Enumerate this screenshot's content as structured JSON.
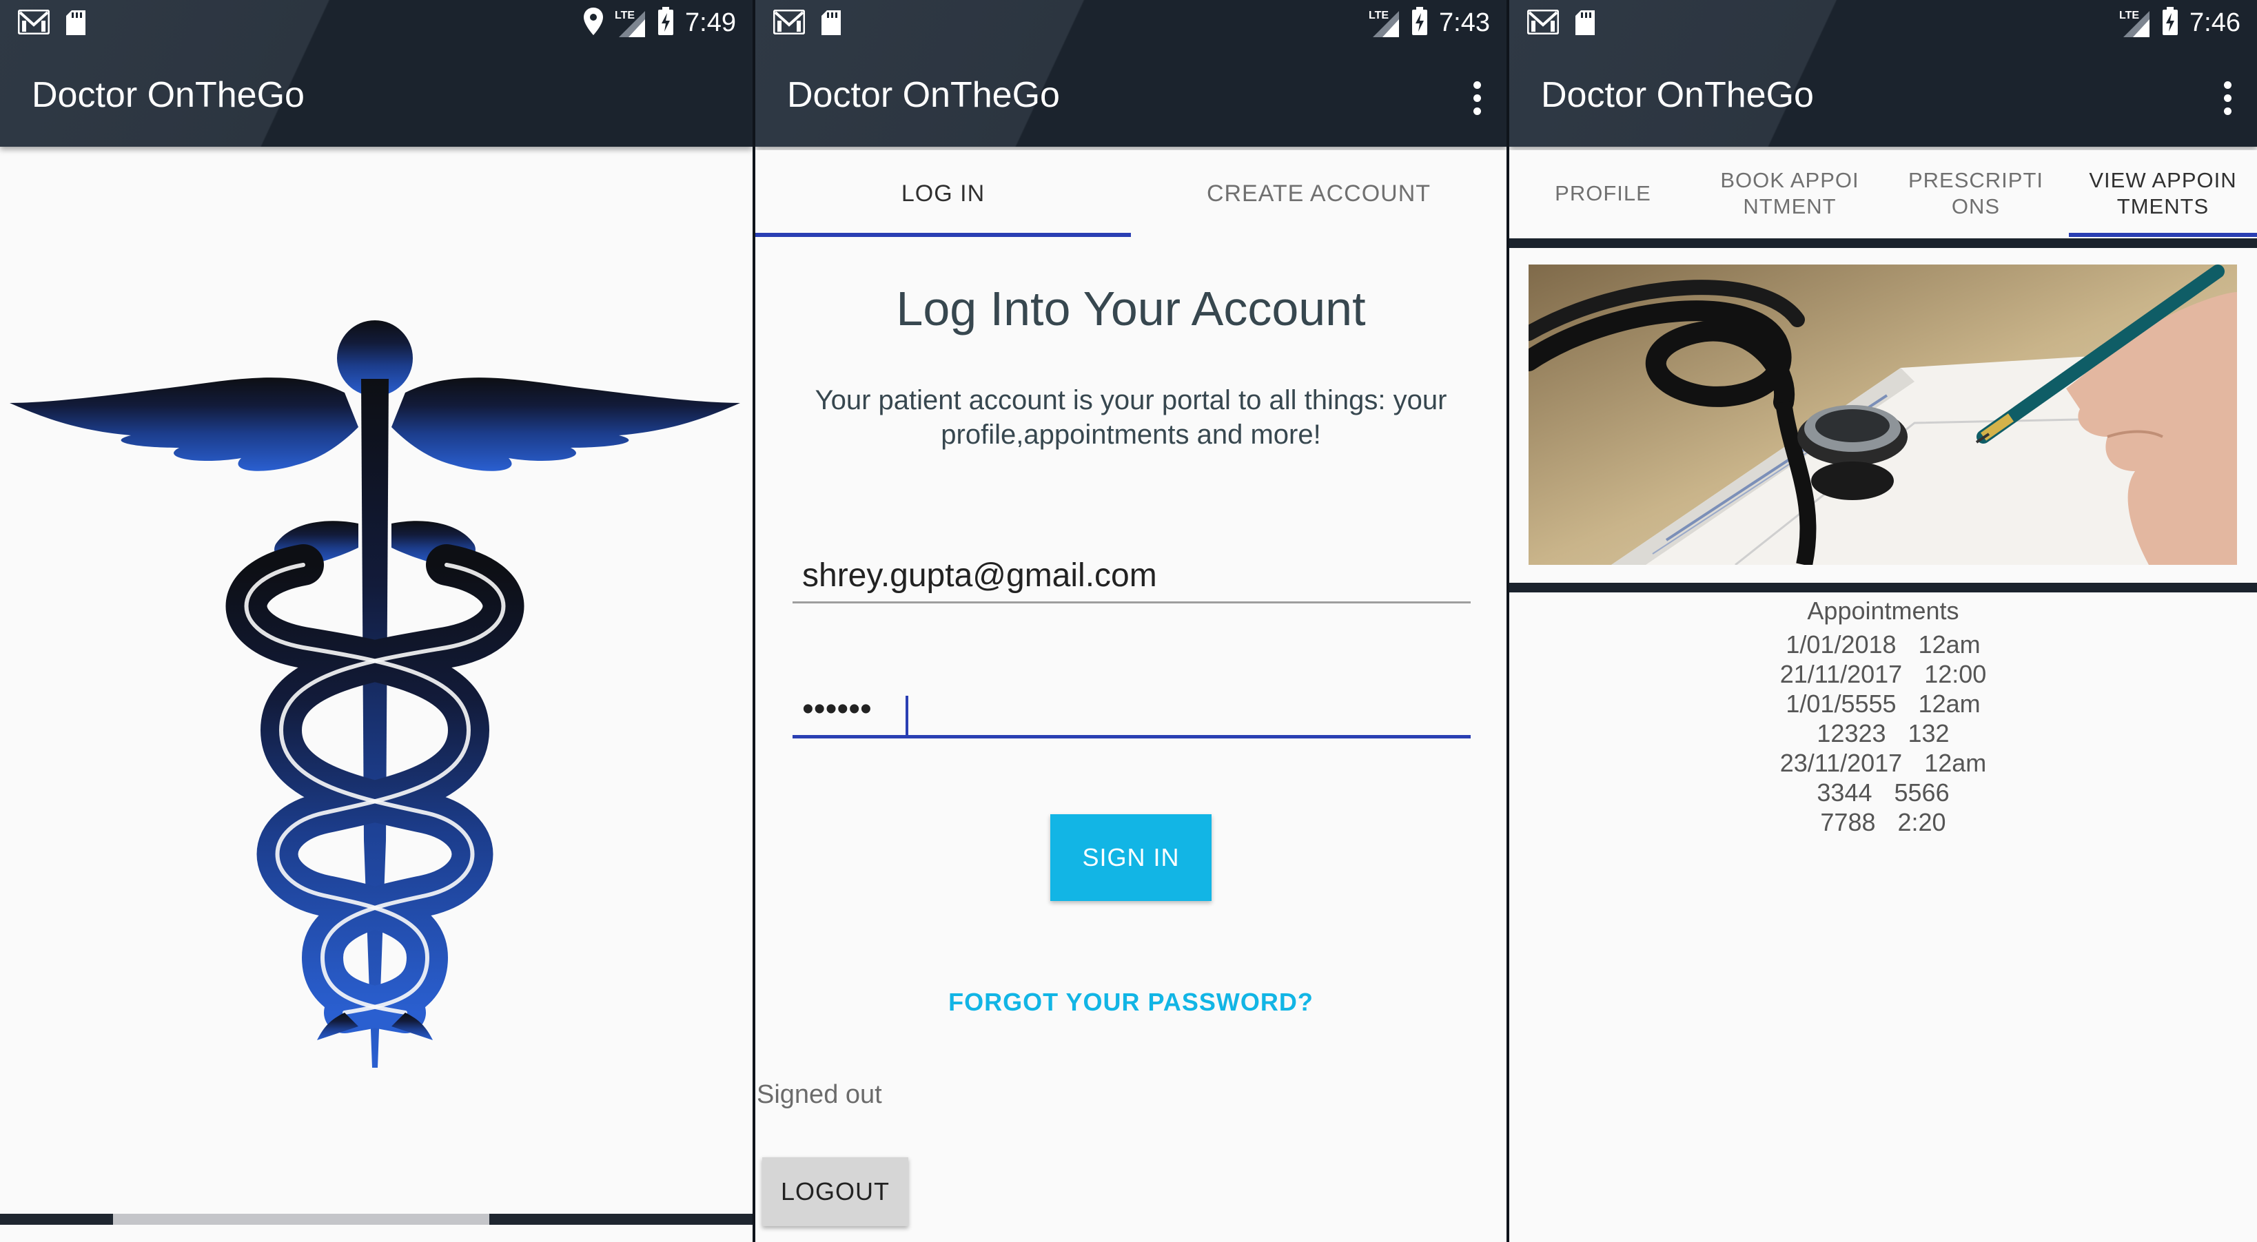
{
  "colors": {
    "appbar": "#1b232d",
    "accent_blue": "#2a3fb3",
    "sign_in_button": "#12b5e5",
    "caduceus_top": "#0d0f14",
    "caduceus_bottom": "#2a5fd0"
  },
  "screens": [
    {
      "status": {
        "time": "7:49",
        "lte": "LTE",
        "icons": [
          "gmail-icon",
          "sd-card-icon",
          "location-icon",
          "signal-icon",
          "battery-charging-icon"
        ]
      },
      "app_title": "Doctor OnTheGo",
      "logo": "caduceus-logo",
      "progress": 0.65
    },
    {
      "status": {
        "time": "7:43",
        "lte": "LTE",
        "icons": [
          "gmail-icon",
          "sd-card-icon",
          "signal-icon",
          "battery-charging-icon"
        ]
      },
      "app_title": "Doctor OnTheGo",
      "tabs": [
        {
          "label": "LOG IN",
          "active": true
        },
        {
          "label": "CREATE ACCOUNT",
          "active": false
        }
      ],
      "heading": "Log Into Your Account",
      "subtext": "Your patient account is your portal to all things: your profile,appointments and more!",
      "email_value": "shrey.gupta@gmail.com",
      "password_value": "••••••",
      "sign_in_label": "SIGN IN",
      "forgot_label": "FORGOT YOUR PASSWORD?",
      "status_text": "Signed out",
      "logout_label": "LOGOUT"
    },
    {
      "status": {
        "time": "7:46",
        "lte": "LTE",
        "icons": [
          "gmail-icon",
          "sd-card-icon",
          "signal-icon",
          "battery-charging-icon"
        ]
      },
      "app_title": "Doctor OnTheGo",
      "tabs": [
        {
          "line1": "PROFILE",
          "line2": "",
          "active": false
        },
        {
          "line1": "BOOK APPOI",
          "line2": "NTMENT",
          "active": false
        },
        {
          "line1": "PRESCRIPTI",
          "line2": "ONS",
          "active": false
        },
        {
          "line1": "VIEW APPOIN",
          "line2": "TMENTS",
          "active": true
        }
      ],
      "photo": "stethoscope-and-diary-photo",
      "appointments_title": "Appointments",
      "appointments": [
        {
          "date": "1/01/2018",
          "time": "12am"
        },
        {
          "date": "21/11/2017",
          "time": "12:00"
        },
        {
          "date": "1/01/5555",
          "time": "12am"
        },
        {
          "date": "12323",
          "time": "132"
        },
        {
          "date": "23/11/2017",
          "time": "12am"
        },
        {
          "date": "3344",
          "time": "5566"
        },
        {
          "date": "7788",
          "time": "2:20"
        }
      ]
    }
  ]
}
